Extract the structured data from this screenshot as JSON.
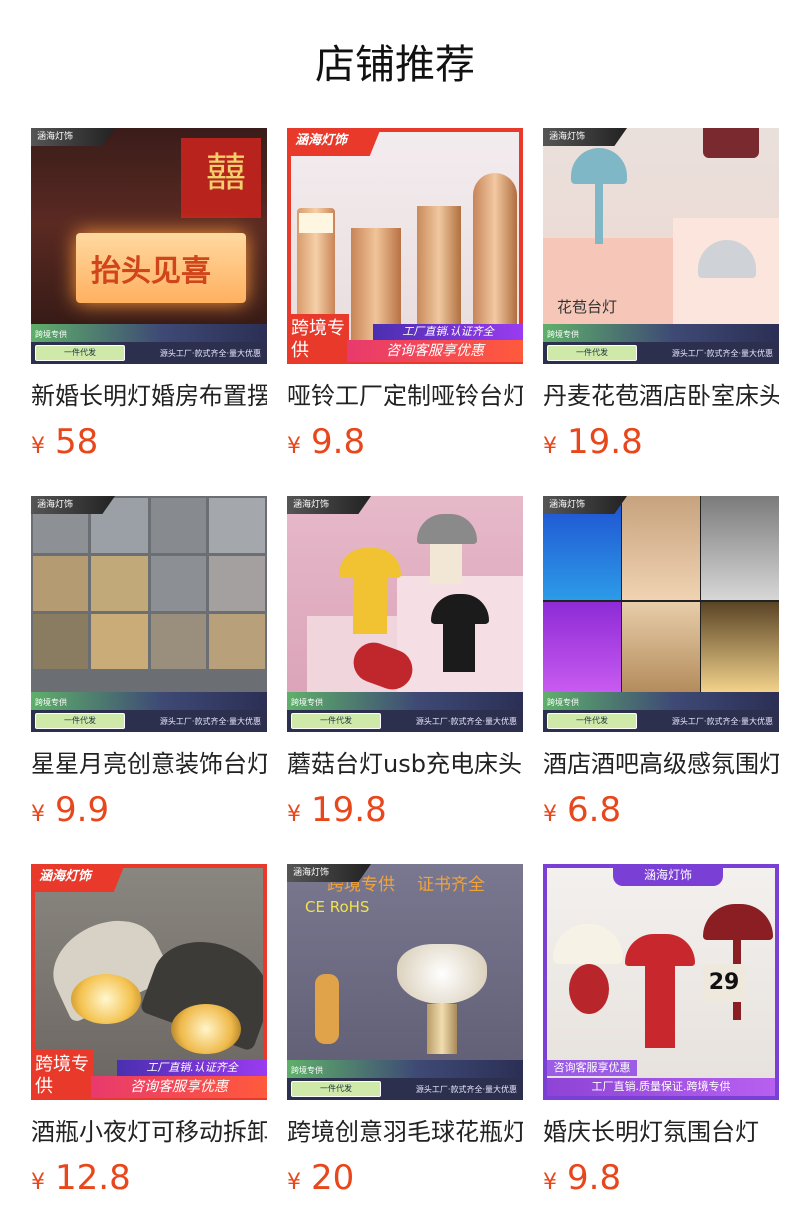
{
  "header": {
    "title": "店铺推荐"
  },
  "products": [
    {
      "name": "新婚长明灯婚房布置摆件",
      "price": "58",
      "currency": "¥",
      "tag": "涵海灯饰",
      "bottom_left": "一件代发",
      "bottom_right": "源头工厂·款式齐全·量大优惠",
      "side_label": "跨境专供"
    },
    {
      "name": "哑铃工厂定制哑铃台灯",
      "price": "9.8",
      "currency": "¥",
      "tag": "涵海灯饰",
      "promo_top": "工厂直销.认证齐全",
      "promo_bottom": "咨询客服享优惠",
      "cross_border": "跨境专供"
    },
    {
      "name": "丹麦花苞酒店卧室床头灯",
      "price": "19.8",
      "currency": "¥",
      "tag": "涵海灯饰",
      "bottom_left": "一件代发",
      "bottom_right": "源头工厂·款式齐全·量大优惠",
      "side_label": "跨境专供",
      "overlay_text": "花苞台灯"
    },
    {
      "name": "星星月亮创意装饰台灯",
      "price": "9.9",
      "currency": "¥",
      "tag": "涵海灯饰",
      "bottom_left": "一件代发",
      "bottom_right": "源头工厂·款式齐全·量大优惠",
      "side_label": "跨境专供"
    },
    {
      "name": "蘑菇台灯usb充电床头灯",
      "price": "19.8",
      "currency": "¥",
      "tag": "涵海灯饰",
      "bottom_left": "一件代发",
      "bottom_right": "源头工厂·款式齐全·量大优惠",
      "side_label": "跨境专供"
    },
    {
      "name": "酒店酒吧高级感氛围灯",
      "price": "6.8",
      "currency": "¥",
      "tag": "涵海灯饰",
      "bottom_left": "一件代发",
      "bottom_right": "源头工厂·款式齐全·量大优惠",
      "side_label": "跨境专供"
    },
    {
      "name": "酒瓶小夜灯可移动拆卸",
      "price": "12.8",
      "currency": "¥",
      "tag": "涵海灯饰",
      "promo_top": "工厂直销.认证齐全",
      "promo_bottom": "咨询客服享优惠",
      "cross_border": "跨境专供"
    },
    {
      "name": "跨境创意羽毛球花瓶灯",
      "price": "20",
      "currency": "¥",
      "tag": "涵海灯饰",
      "bottom_left": "一件代发",
      "bottom_right": "源头工厂·款式齐全·量大优惠",
      "side_label": "跨境专供",
      "overlay_top_left": "跨境专供",
      "overlay_top_right": "证书齐全",
      "cert": "CE    RoHS"
    },
    {
      "name": "婚庆长明灯氛围台灯",
      "price": "9.8",
      "currency": "¥",
      "tag": "涵海灯饰",
      "promo_top": "咨询客服享优惠",
      "promo_bottom": "工厂直销.质量保证.跨境专供",
      "clock": "29"
    }
  ]
}
